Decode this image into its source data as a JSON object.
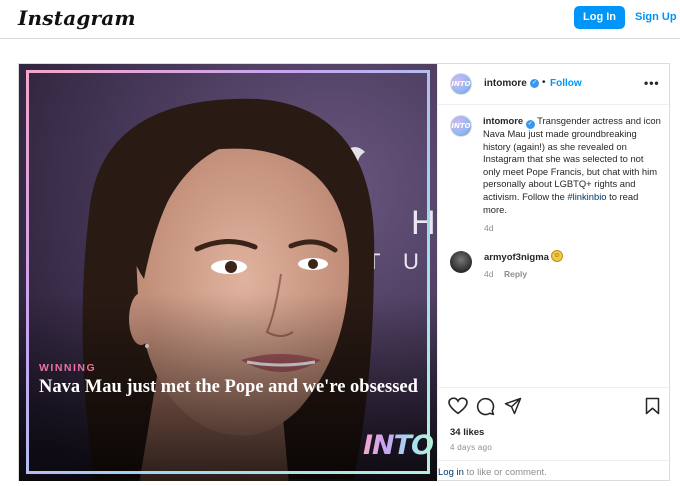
{
  "topbar": {
    "logo": "Instagram",
    "login_label": "Log In",
    "signup_label": "Sign Up"
  },
  "post": {
    "image": {
      "kicker": "WINNING",
      "headline": "Nava Mau just met the Pope and we're obsessed",
      "brand_logo": "INTO",
      "backdrop_letters": [
        "H",
        "T",
        "U"
      ]
    },
    "header": {
      "avatar_text": "INTO",
      "username": "intomore",
      "separator": "•",
      "follow_label": "Follow",
      "more_label": "•••"
    },
    "caption": {
      "username": "intomore",
      "text": "Transgender actress and icon Nava Mau just made groundbreaking history (again!) as she revealed on Instagram that she was selected to not only meet Pope Francis, but chat with him personally about LGBTQ+ rights and activism. Follow the",
      "hashtag": "#linkinbio",
      "text_end": "to read more.",
      "time": "4d"
    },
    "comments": [
      {
        "username": "armyof3nigma",
        "emoji": "😄",
        "time": "4d",
        "reply_label": "Reply"
      }
    ],
    "actions": {
      "icons": [
        "heart-icon",
        "comment-icon",
        "share-icon",
        "bookmark-icon"
      ]
    },
    "likes": "34 likes",
    "posted_ago": "4 days ago",
    "login_prompt": {
      "link": "Log in",
      "rest": "to like or comment."
    }
  },
  "colors": {
    "accent": "#0095f6",
    "kicker": "#e8739f",
    "border": "#dbdbdb"
  }
}
